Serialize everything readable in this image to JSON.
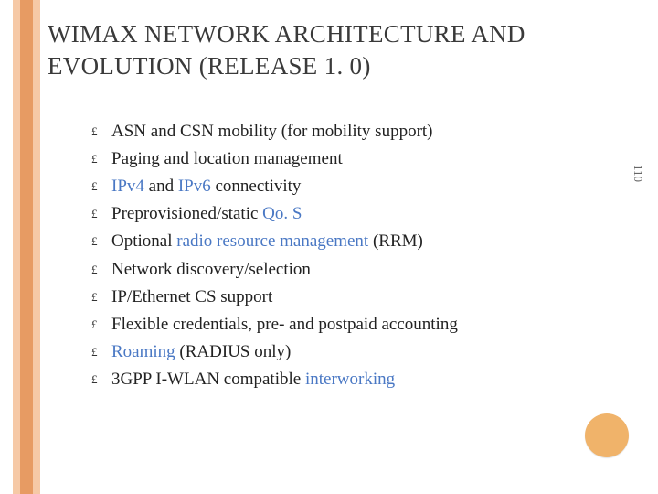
{
  "title_parts": [
    "W",
    "I",
    "MAX N",
    "ETWORK",
    " A",
    "RCHITECTURE AND",
    " E",
    "VOLUTION",
    " (R",
    "ELEASE",
    " 1. 0)"
  ],
  "bullet_glyph": "£",
  "page_number": "110",
  "items": [
    {
      "segments": [
        {
          "t": "ASN and CSN mobility (for mobility support)",
          "link": false
        }
      ]
    },
    {
      "segments": [
        {
          "t": "Paging and location management",
          "link": false
        }
      ]
    },
    {
      "segments": [
        {
          "t": "IPv4",
          "link": true
        },
        {
          "t": " and ",
          "link": false
        },
        {
          "t": "IPv6",
          "link": true
        },
        {
          "t": " connectivity",
          "link": false
        }
      ]
    },
    {
      "segments": [
        {
          "t": "Preprovisioned/static ",
          "link": false
        },
        {
          "t": "Qo. S",
          "link": true
        }
      ]
    },
    {
      "segments": [
        {
          "t": "Optional ",
          "link": false
        },
        {
          "t": "radio resource management",
          "link": true
        },
        {
          "t": " (RRM)",
          "link": false
        }
      ]
    },
    {
      "segments": [
        {
          "t": "Network discovery/selection",
          "link": false
        }
      ]
    },
    {
      "segments": [
        {
          "t": "IP/Ethernet CS support",
          "link": false
        }
      ]
    },
    {
      "segments": [
        {
          "t": "Flexible credentials, pre- and postpaid accounting",
          "link": false
        }
      ]
    },
    {
      "segments": [
        {
          "t": "Roaming",
          "link": true
        },
        {
          "t": " (RADIUS only)",
          "link": false
        }
      ]
    },
    {
      "segments": [
        {
          "t": "3GPP I-WLAN compatible ",
          "link": false
        },
        {
          "t": "interworking",
          "link": true
        }
      ]
    }
  ]
}
